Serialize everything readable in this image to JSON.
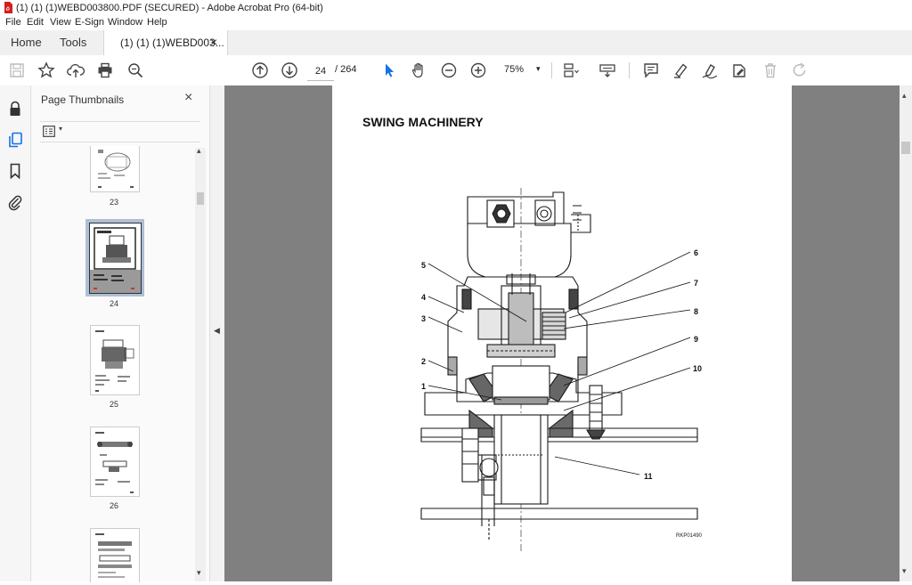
{
  "window": {
    "title": "(1) (1) (1)WEBD003800.PDF (SECURED) - Adobe Acrobat Pro (64-bit)"
  },
  "menu": [
    "File",
    "Edit",
    "View",
    "E-Sign",
    "Window",
    "Help"
  ],
  "tabs": {
    "home": "Home",
    "tools": "Tools",
    "document": "(1) (1) (1)WEBD003...",
    "close": "×"
  },
  "toolbar": {
    "current_page": "24",
    "total_pages": "/ 264",
    "zoom": "75%"
  },
  "thumbnails": {
    "header": "Page Thumbnails",
    "close": "×",
    "pages": [
      {
        "label": "23",
        "selected": false
      },
      {
        "label": "24",
        "selected": true
      },
      {
        "label": "25",
        "selected": false
      },
      {
        "label": "26",
        "selected": false
      }
    ]
  },
  "document": {
    "title": "SWING MACHINERY",
    "figure_code": "RKP01490",
    "callouts": [
      "1",
      "2",
      "3",
      "4",
      "5",
      "6",
      "7",
      "8",
      "9",
      "10",
      "11"
    ]
  },
  "colors": {
    "accent": "#1473e6",
    "selection": "#aebfd6",
    "viewer_bg": "#808080",
    "pdf_icon": "#d11f1f"
  }
}
